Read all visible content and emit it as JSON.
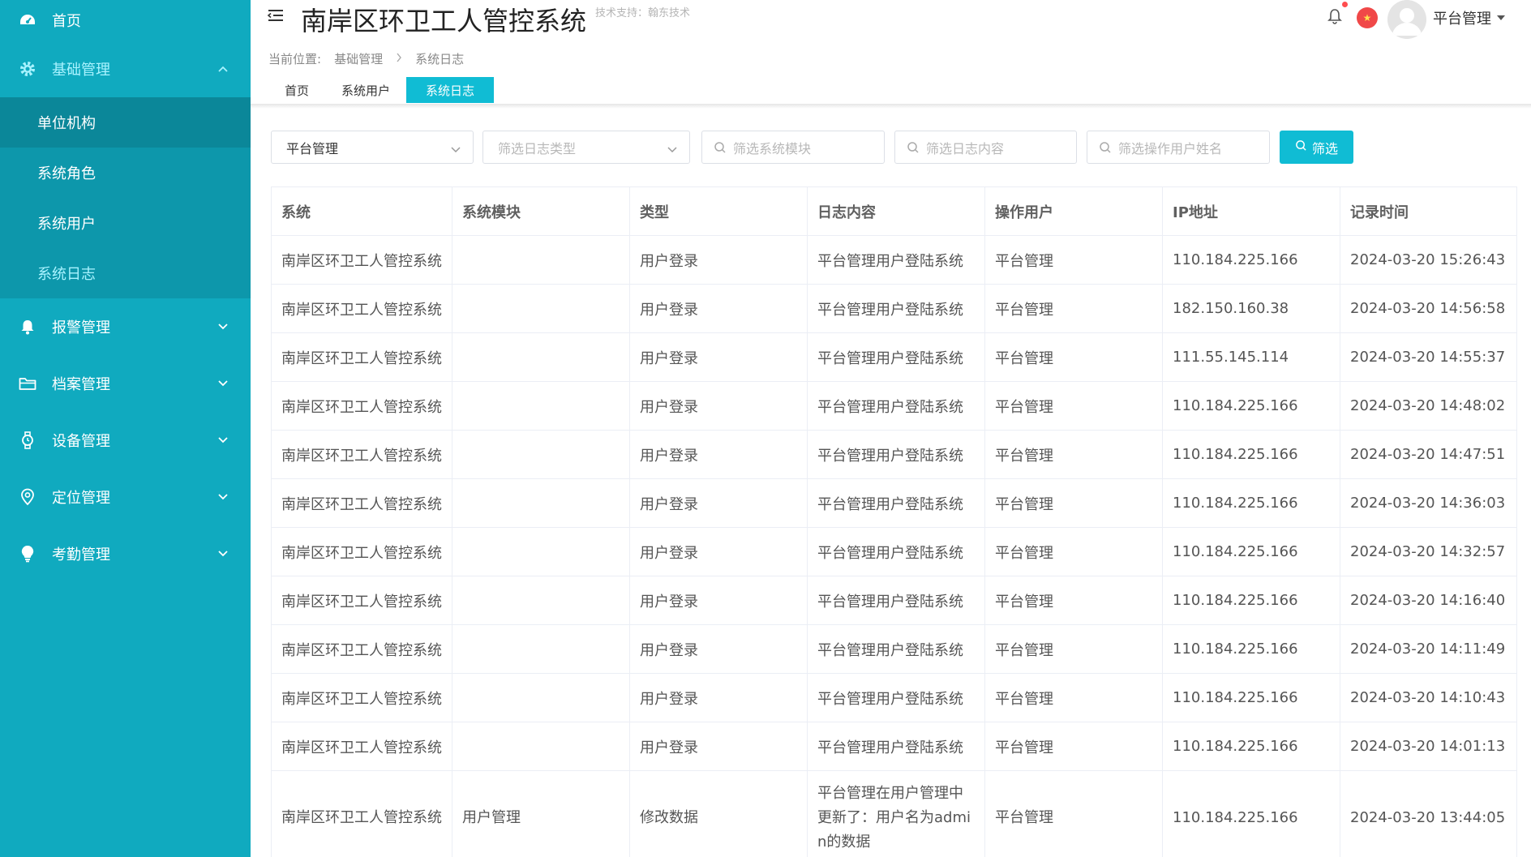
{
  "sidebar": {
    "home": "首页",
    "groups": [
      {
        "label": "基础管理",
        "icon": "gear-icon"
      },
      {
        "label": "报警管理",
        "icon": "bell-icon"
      },
      {
        "label": "档案管理",
        "icon": "folder-icon"
      },
      {
        "label": "设备管理",
        "icon": "watch-icon"
      },
      {
        "label": "定位管理",
        "icon": "location-pin-icon"
      },
      {
        "label": "考勤管理",
        "icon": "lightbulb-icon"
      }
    ],
    "sub_items": [
      "单位机构",
      "系统角色",
      "系统用户",
      "系统日志"
    ]
  },
  "header": {
    "title": "南岸区环卫工人管控系统",
    "tech_support": "技术支持：翰东技术",
    "user_name": "平台管理"
  },
  "breadcrumb": {
    "prefix": "当前位置:",
    "items": [
      "基础管理",
      "系统日志"
    ]
  },
  "tabs": [
    "首页",
    "系统用户",
    "系统日志"
  ],
  "filters": {
    "system_value": "平台管理",
    "log_type_placeholder": "筛选日志类型",
    "module_placeholder": "筛选系统模块",
    "content_placeholder": "筛选日志内容",
    "user_placeholder": "筛选操作用户姓名",
    "button_label": "筛选"
  },
  "table": {
    "headers": [
      "系统",
      "系统模块",
      "类型",
      "日志内容",
      "操作用户",
      "IP地址",
      "记录时间"
    ],
    "rows": [
      [
        "南岸区环卫工人管控系统",
        "",
        "用户登录",
        "平台管理用户登陆系统",
        "平台管理",
        "110.184.225.166",
        "2024-03-20 15:26:43"
      ],
      [
        "南岸区环卫工人管控系统",
        "",
        "用户登录",
        "平台管理用户登陆系统",
        "平台管理",
        "182.150.160.38",
        "2024-03-20 14:56:58"
      ],
      [
        "南岸区环卫工人管控系统",
        "",
        "用户登录",
        "平台管理用户登陆系统",
        "平台管理",
        "111.55.145.114",
        "2024-03-20 14:55:37"
      ],
      [
        "南岸区环卫工人管控系统",
        "",
        "用户登录",
        "平台管理用户登陆系统",
        "平台管理",
        "110.184.225.166",
        "2024-03-20 14:48:02"
      ],
      [
        "南岸区环卫工人管控系统",
        "",
        "用户登录",
        "平台管理用户登陆系统",
        "平台管理",
        "110.184.225.166",
        "2024-03-20 14:47:51"
      ],
      [
        "南岸区环卫工人管控系统",
        "",
        "用户登录",
        "平台管理用户登陆系统",
        "平台管理",
        "110.184.225.166",
        "2024-03-20 14:36:03"
      ],
      [
        "南岸区环卫工人管控系统",
        "",
        "用户登录",
        "平台管理用户登陆系统",
        "平台管理",
        "110.184.225.166",
        "2024-03-20 14:32:57"
      ],
      [
        "南岸区环卫工人管控系统",
        "",
        "用户登录",
        "平台管理用户登陆系统",
        "平台管理",
        "110.184.225.166",
        "2024-03-20 14:16:40"
      ],
      [
        "南岸区环卫工人管控系统",
        "",
        "用户登录",
        "平台管理用户登陆系统",
        "平台管理",
        "110.184.225.166",
        "2024-03-20 14:11:49"
      ],
      [
        "南岸区环卫工人管控系统",
        "",
        "用户登录",
        "平台管理用户登陆系统",
        "平台管理",
        "110.184.225.166",
        "2024-03-20 14:10:43"
      ],
      [
        "南岸区环卫工人管控系统",
        "",
        "用户登录",
        "平台管理用户登陆系统",
        "平台管理",
        "110.184.225.166",
        "2024-03-20 14:01:13"
      ],
      [
        "南岸区环卫工人管控系统",
        "用户管理",
        "修改数据",
        "平台管理在用户管理中更新了：用户名为admin的数据",
        "平台管理",
        "110.184.225.166",
        "2024-03-20 13:44:05"
      ]
    ]
  },
  "colors": {
    "sidebar_bg": "#10aabf",
    "accent": "#10bcd4",
    "submenu_active_text": "#a9f3ff"
  }
}
